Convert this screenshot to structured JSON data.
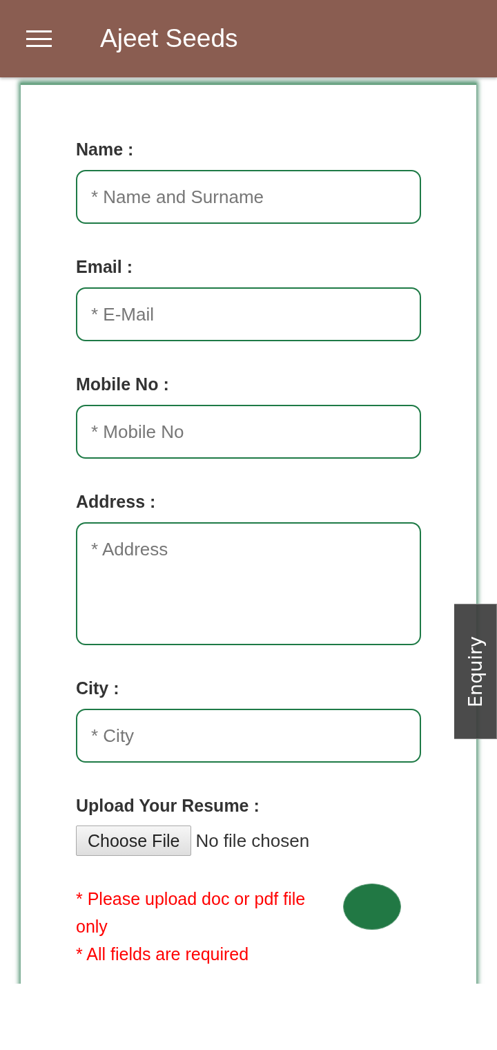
{
  "app_bar": {
    "title": "Ajeet Seeds"
  },
  "form": {
    "fields": [
      {
        "kind": "input",
        "label": "Name :",
        "placeholder": "* Name and Surname"
      },
      {
        "kind": "input",
        "label": "Email :",
        "placeholder": "* E-Mail"
      },
      {
        "kind": "input",
        "label": "Mobile No :",
        "placeholder": "* Mobile No"
      },
      {
        "kind": "textarea",
        "label": "Address :",
        "placeholder": "* Address"
      },
      {
        "kind": "input",
        "label": "City :",
        "placeholder": "* City"
      }
    ],
    "upload": {
      "label": "Upload Your Resume :",
      "button": "Choose File",
      "status": "No file chosen"
    },
    "notes": [
      "* Please upload doc or pdf file only",
      "* All fields are required"
    ]
  },
  "enquiry_tab": {
    "label": "Enquiry"
  }
}
